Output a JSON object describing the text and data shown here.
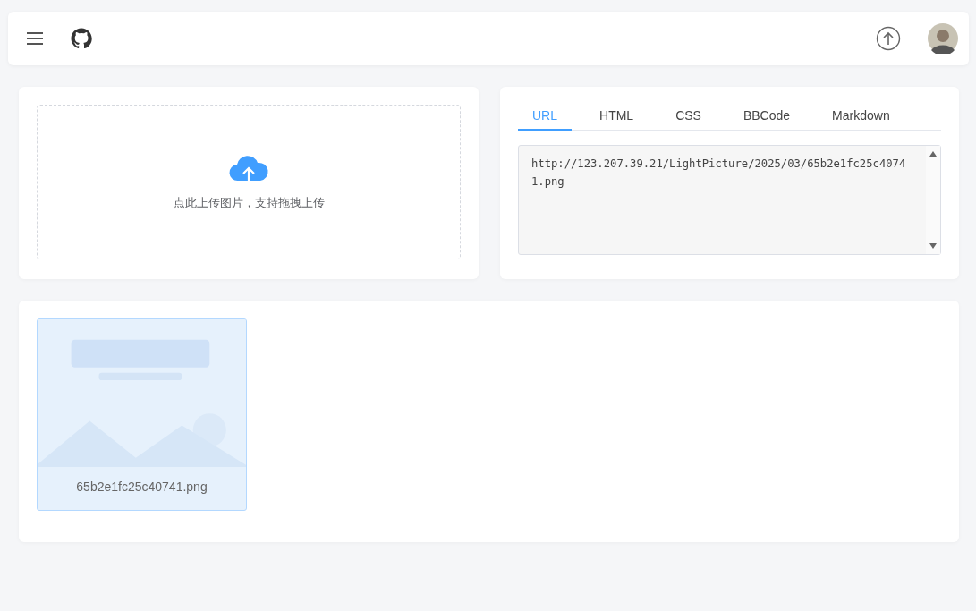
{
  "upload": {
    "hint": "点此上传图片，支持拖拽上传"
  },
  "link_tabs": [
    {
      "label": "URL",
      "selected": true
    },
    {
      "label": "HTML",
      "selected": false
    },
    {
      "label": "CSS",
      "selected": false
    },
    {
      "label": "BBCode",
      "selected": false
    },
    {
      "label": "Markdown",
      "selected": false
    }
  ],
  "link_field": {
    "value": "http://123.207.39.21/LightPicture/2025/03/65b2e1fc25c40741.png"
  },
  "gallery": [
    {
      "kind": "picture",
      "filename": "65b2e1fc25c40741.png",
      "selected": true
    }
  ]
}
